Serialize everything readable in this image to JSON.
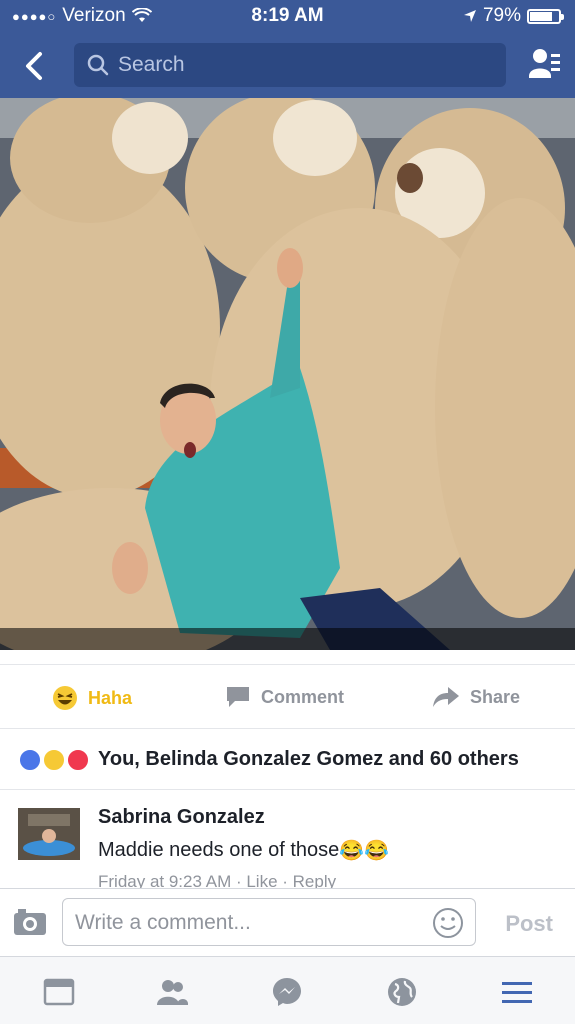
{
  "status_bar": {
    "carrier": "Verizon",
    "time": "8:19 AM",
    "battery": "79%",
    "battery_level": 0.79
  },
  "nav": {
    "search_placeholder": "Search"
  },
  "actions": {
    "haha": "Haha",
    "comment": "Comment",
    "share": "Share"
  },
  "reactions": {
    "summary": "You, Belinda Gonzalez Gomez and 60 others",
    "colors": {
      "like": "#4a76e8",
      "haha": "#f6c935",
      "love": "#f0384f"
    }
  },
  "comment": {
    "author": "Sabrina Gonzalez",
    "text": "Maddie needs one of those",
    "emoji": "😂😂",
    "meta": "Friday at 9:23 AM · Like · Reply"
  },
  "composer": {
    "placeholder": "Write a comment...",
    "post_label": "Post"
  },
  "tabs": [
    "news-feed-icon",
    "friends-icon",
    "messenger-icon",
    "globe-icon",
    "menu-icon"
  ],
  "colors": {
    "brand": "#3b5998",
    "active_tab": "#4267b2"
  }
}
